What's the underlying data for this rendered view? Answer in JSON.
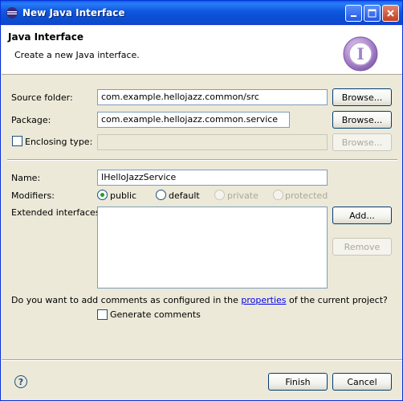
{
  "window": {
    "title": "New Java Interface",
    "controls": [
      "minimize-icon",
      "maximize-icon",
      "close-icon"
    ]
  },
  "banner": {
    "title": "Java Interface",
    "description": "Create a new Java interface.",
    "badge_letter": "I"
  },
  "form": {
    "source_folder": {
      "label": "Source folder:",
      "value": "com.example.hellojazz.common/src",
      "browse_label": "Browse..."
    },
    "package": {
      "label": "Package:",
      "value": "com.example.hellojazz.common.service",
      "browse_label": "Browse..."
    },
    "enclosing_type": {
      "label": "Enclosing type:",
      "value": "",
      "checked": false,
      "browse_label": "Browse..."
    },
    "name": {
      "label": "Name:",
      "value": "IHelloJazzService"
    },
    "modifiers": {
      "label": "Modifiers:",
      "options": [
        {
          "label": "public",
          "selected": true,
          "enabled": true
        },
        {
          "label": "default",
          "selected": false,
          "enabled": true
        },
        {
          "label": "private",
          "selected": false,
          "enabled": false
        },
        {
          "label": "protected",
          "selected": false,
          "enabled": false
        }
      ]
    },
    "extended_interfaces": {
      "label": "Extended interfaces:",
      "items": [],
      "add_label": "Add...",
      "remove_label": "Remove"
    },
    "comments": {
      "question_before": "Do you want to add comments as configured in the ",
      "link": "properties",
      "question_after": " of the current project?",
      "checkbox_label": "Generate comments",
      "checked": false
    }
  },
  "footer": {
    "help_icon": "help-icon",
    "finish_label": "Finish",
    "cancel_label": "Cancel"
  },
  "colors": {
    "titlebar": "#0a4fd5",
    "dialog_bg": "#ece9d8",
    "link": "#0000ee",
    "radio_selected": "#21a121"
  }
}
